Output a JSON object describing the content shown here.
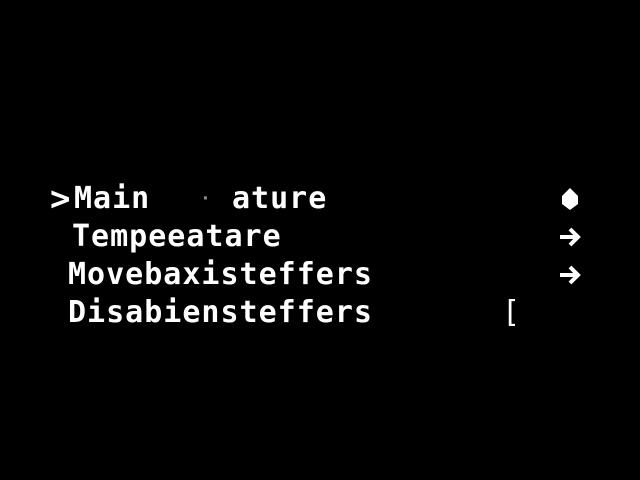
{
  "colors": {
    "background": "#000000",
    "foreground": "#ffffff"
  },
  "menu": {
    "cursor_glyph": ">",
    "items": [
      {
        "label": "Main",
        "overlay": "ature",
        "icon": "back-dot-icon",
        "selected": true
      },
      {
        "label": "Tempeeatare",
        "overlay": "",
        "icon": "arrow-right-icon",
        "selected": false
      },
      {
        "label": "Movebaxisteffers",
        "overlay": "",
        "icon": "arrow-right-icon",
        "selected": false
      },
      {
        "label": "Disabiensteffers",
        "overlay": "[",
        "icon": "",
        "selected": false
      }
    ]
  }
}
